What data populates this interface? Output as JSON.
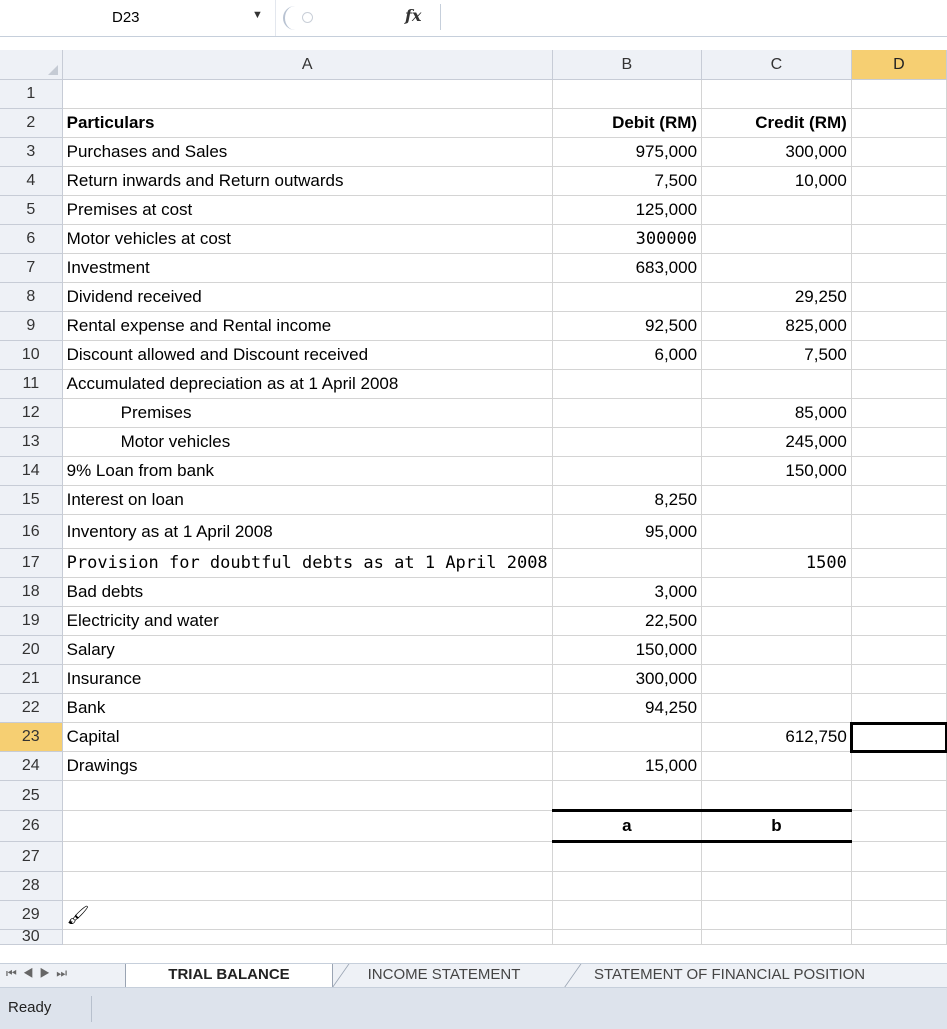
{
  "namebox": "D23",
  "columns": [
    "A",
    "B",
    "C",
    "D"
  ],
  "header": {
    "particulars": "Particulars",
    "debit": "Debit (RM)",
    "credit": "Credit (RM)"
  },
  "rows": [
    {
      "n": "1",
      "a": "",
      "b": "",
      "c": ""
    },
    {
      "n": "2",
      "a": "",
      "b": "",
      "c": ""
    },
    {
      "n": "3",
      "a": "Purchases and Sales",
      "b": "975,000",
      "c": "300,000"
    },
    {
      "n": "4",
      "a": "Return inwards and Return outwards",
      "b": "7,500",
      "c": "10,000"
    },
    {
      "n": "5",
      "a": "Premises at cost",
      "b": "125,000",
      "c": ""
    },
    {
      "n": "6",
      "a": "Motor vehicles at cost",
      "b": "300000",
      "c": ""
    },
    {
      "n": "7",
      "a": "Investment",
      "b": "683,000",
      "c": ""
    },
    {
      "n": "8",
      "a": "Dividend received",
      "b": "",
      "c": "29,250"
    },
    {
      "n": "9",
      "a": "Rental expense and Rental income",
      "b": "92,500",
      "c": "825,000"
    },
    {
      "n": "10",
      "a": "Discount allowed and Discount received",
      "b": "6,000",
      "c": "7,500"
    },
    {
      "n": "11",
      "a": "Accumulated depreciation as at 1 April 2008",
      "b": "",
      "c": ""
    },
    {
      "n": "12",
      "a": "Premises",
      "b": "",
      "c": "85,000"
    },
    {
      "n": "13",
      "a": "Motor vehicles",
      "b": "",
      "c": "245,000"
    },
    {
      "n": "14",
      "a": "9% Loan from bank",
      "b": "",
      "c": "150,000"
    },
    {
      "n": "15",
      "a": "Interest on loan",
      "b": "8,250",
      "c": ""
    },
    {
      "n": "16",
      "a": "Inventory as at 1 April 2008",
      "b": "95,000",
      "c": ""
    },
    {
      "n": "17",
      "a": "Provision for doubtful debts as at 1 April 2008",
      "b": "",
      "c": "1500"
    },
    {
      "n": "18",
      "a": "Bad debts",
      "b": "3,000",
      "c": ""
    },
    {
      "n": "19",
      "a": "Electricity and water",
      "b": "22,500",
      "c": ""
    },
    {
      "n": "20",
      "a": "Salary",
      "b": "150,000",
      "c": ""
    },
    {
      "n": "21",
      "a": "Insurance",
      "b": "300,000",
      "c": ""
    },
    {
      "n": "22",
      "a": "Bank",
      "b": "94,250",
      "c": ""
    },
    {
      "n": "23",
      "a": "Capital",
      "b": "",
      "c": "612,750"
    },
    {
      "n": "24",
      "a": "Drawings",
      "b": "15,000",
      "c": ""
    },
    {
      "n": "25",
      "a": "",
      "b": "",
      "c": ""
    },
    {
      "n": "26",
      "a": "",
      "b": "a",
      "c": "b"
    },
    {
      "n": "27",
      "a": "",
      "b": "",
      "c": ""
    },
    {
      "n": "28",
      "a": "",
      "b": "",
      "c": ""
    },
    {
      "n": "29",
      "a": "",
      "b": "",
      "c": ""
    },
    {
      "n": "30",
      "a": "",
      "b": "",
      "c": ""
    }
  ],
  "sheet_tabs": [
    "TRIAL BALANCE",
    "INCOME STATEMENT",
    "STATEMENT OF FINANCIAL POSITION"
  ],
  "status": "Ready",
  "icons": {
    "paste_options": "paintbrush-icon",
    "fx": "fx-icon",
    "namebox_dropdown": "chevron-down-icon"
  }
}
